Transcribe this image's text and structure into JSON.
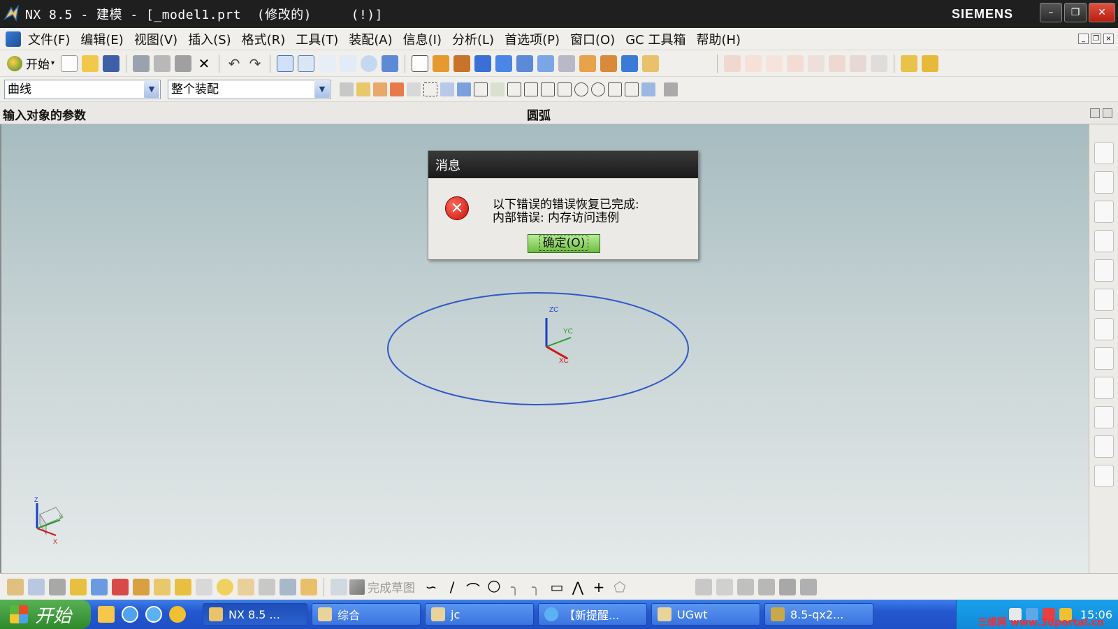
{
  "window": {
    "title": "NX 8.5 - 建模 - [_model1.prt  (修改的)     (!)]",
    "brand": "SIEMENS"
  },
  "menu": {
    "items": [
      "文件(F)",
      "编辑(E)",
      "视图(V)",
      "插入(S)",
      "格式(R)",
      "工具(T)",
      "装配(A)",
      "信息(I)",
      "分析(L)",
      "首选项(P)",
      "窗口(O)",
      "GC 工具箱",
      "帮助(H)"
    ]
  },
  "toolbar": {
    "start_label": "开始",
    "finish_sketch_label": "完成草图"
  },
  "selection": {
    "type_filter": "曲线",
    "scope": "整个装配"
  },
  "cue": {
    "prompt": "输入对象的参数",
    "status": "圆弧"
  },
  "dialog": {
    "title": "消息",
    "line1": "以下错误的错误恢复已完成:",
    "line2": "内部错误: 内存访问违例",
    "ok_label": "确定(O)"
  },
  "axes": {
    "zc": "ZC",
    "yc": "YC",
    "xc": "XC",
    "z": "Z",
    "y": "Y",
    "x": "X"
  },
  "taskbar": {
    "start": "开始",
    "tasks": [
      "NX 8.5 ...",
      "综合",
      "jc",
      "【新提醒...",
      "UGwt",
      "8.5-qx2..."
    ],
    "clock": "15:06",
    "watermark": "三维网 www.3dportal.cn"
  },
  "colors": {
    "arc": "#2f57c8",
    "zc_axis": "#1a3fc8",
    "yc_axis": "#2a9a2a",
    "xc_axis": "#c81a1a"
  }
}
